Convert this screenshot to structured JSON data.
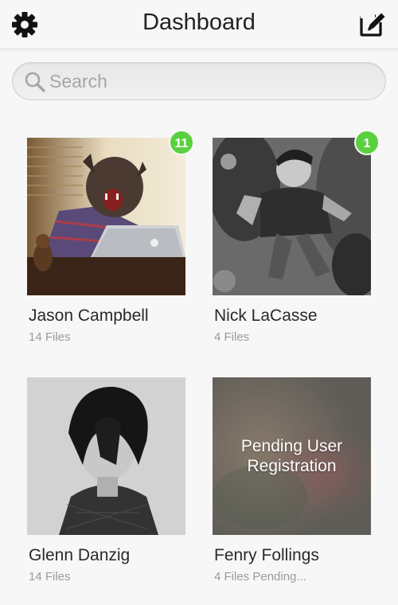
{
  "header": {
    "title": "Dashboard",
    "settings_icon": "gear-icon",
    "compose_icon": "compose-icon"
  },
  "search": {
    "placeholder": "Search",
    "value": ""
  },
  "users": [
    {
      "name": "Jason Campbell",
      "subtitle": "14 Files",
      "badge": "11",
      "photo": "werewolf-mask-at-laptop"
    },
    {
      "name": "Nick LaCasse",
      "subtitle": "4 Files",
      "badge": "1",
      "photo": "bw-dancing-man-in-crowd"
    },
    {
      "name": "Glenn Danzig",
      "subtitle": "14 Files",
      "badge": null,
      "photo": "bw-portrait-dark-hair"
    },
    {
      "name": "Fenry Follings",
      "subtitle": "4 Files Pending...",
      "badge": null,
      "photo": "blurred-placeholder",
      "overlay": "Pending User Registration"
    }
  ],
  "colors": {
    "badge": "#5ad03f",
    "background": "#f7f7f7"
  }
}
